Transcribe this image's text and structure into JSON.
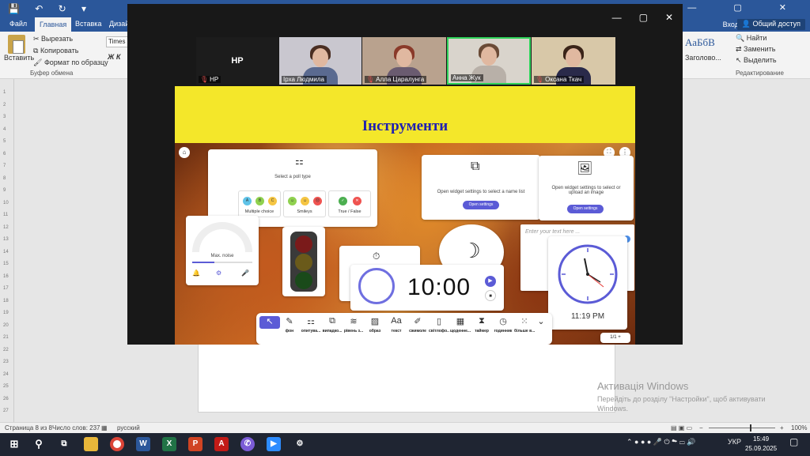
{
  "word": {
    "tabs": [
      "Файл",
      "Главная",
      "Вставка",
      "Дизай"
    ],
    "login": "Вход",
    "share": "Общий доступ",
    "ribbon": {
      "paste": "Вставить",
      "cut": "Вырезать",
      "copy": "Копировать",
      "format_painter": "Формат по образцу",
      "clipboard_group": "Буфер обмена",
      "font_name": "Times",
      "bold_italic": "Ж К",
      "style_preview": "АаБбВ",
      "style_name": "Заголово...",
      "find": "Найти",
      "replace": "Заменить",
      "select": "Выделить",
      "editing_group": "Редактирование"
    },
    "ruler_ticks": [
      "1",
      "2",
      "3",
      "4",
      "5",
      "6",
      "7",
      "8",
      "9",
      "10",
      "11",
      "12",
      "13",
      "14",
      "15",
      "16",
      "17",
      "18",
      "19",
      "20",
      "21",
      "22",
      "23",
      "24",
      "25",
      "26",
      "27"
    ],
    "activation": {
      "title": "Активація Windows",
      "subtitle": "Перейдіть до розділу \"Настройки\", щоб активувати Windows."
    },
    "status": {
      "page": "Страница 8 из 8",
      "words": "Число слов: 237",
      "language": "русский",
      "zoom": "100%"
    }
  },
  "taskbar": {
    "time": "15:49",
    "date": "25.09.2025",
    "language": "УКР"
  },
  "meeting": {
    "participants": [
      {
        "name": "HP",
        "initials": "HP"
      },
      {
        "name": "Ірха Людмила"
      },
      {
        "name": "Алла Царалунга"
      },
      {
        "name": "Анна Жук"
      },
      {
        "name": "Оксана Ткач"
      }
    ],
    "slide": {
      "title": "Інструменти",
      "poll": {
        "prompt": "Select a poll type",
        "options": [
          "Multiple choice",
          "Smileys",
          "True / False"
        ],
        "abc": [
          "A",
          "B",
          "C"
        ]
      },
      "names_widget": {
        "text": "Open widget settings to select a name list",
        "button": "Open settings"
      },
      "image_widget": {
        "text": "Open widget settings to select or upload an image",
        "button": "Open settings"
      },
      "noise_label": "Max. noise",
      "text_placeholder": "Enter your text here ...",
      "timer": "10:00",
      "clock_time": "11:19 PM",
      "pager": "1/1",
      "toolbar": [
        "фон",
        "опитува...",
        "випадко...",
        "рівень з...",
        "образ",
        "текст",
        "сжимоле",
        "світлофо...",
        "щоденне...",
        "таймер",
        "годинник",
        "більше в..."
      ]
    }
  }
}
